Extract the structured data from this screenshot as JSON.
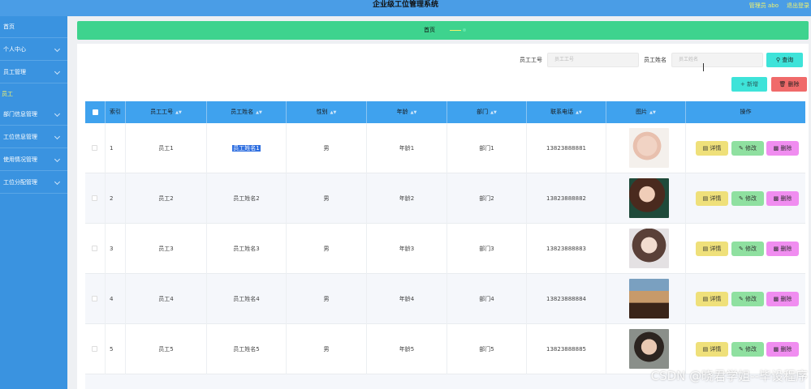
{
  "header": {
    "title": "企业级工位管理系统",
    "admin": "管理员 abo",
    "logout": "退出登录"
  },
  "sidebar": {
    "items": [
      {
        "label": "首页",
        "chevron": false
      },
      {
        "label": "个人中心",
        "chevron": true
      },
      {
        "label": "员工管理",
        "chevron": true
      },
      {
        "label": "部门信息管理",
        "chevron": true
      },
      {
        "label": "工位信息管理",
        "chevron": true
      },
      {
        "label": "使用情况管理",
        "chevron": true
      },
      {
        "label": "工位分配管理",
        "chevron": true
      }
    ],
    "active_sub": "员工"
  },
  "breadcrumb": {
    "home": "首页"
  },
  "search": {
    "id_label": "员工工号",
    "id_placeholder": "员工工号",
    "name_label": "员工姓名",
    "name_placeholder": "员工姓名",
    "query_button": "查询"
  },
  "actions": {
    "add_button": "新增",
    "delete_button": "删除"
  },
  "table": {
    "headers": [
      "索引",
      "员工工号",
      "员工姓名",
      "性别",
      "年龄",
      "部门",
      "联系电话",
      "图片",
      "操作"
    ],
    "row_buttons": {
      "detail": "详情",
      "edit": "修改",
      "delete": "删除"
    },
    "rows": [
      {
        "index": "1",
        "emp_id": "员工1",
        "emp_name": "员工姓名1",
        "gender": "男",
        "age": "年龄1",
        "dept": "部门1",
        "phone": "13823888881"
      },
      {
        "index": "2",
        "emp_id": "员工2",
        "emp_name": "员工姓名2",
        "gender": "男",
        "age": "年龄2",
        "dept": "部门2",
        "phone": "13823888882"
      },
      {
        "index": "3",
        "emp_id": "员工3",
        "emp_name": "员工姓名3",
        "gender": "男",
        "age": "年龄3",
        "dept": "部门3",
        "phone": "13823888883"
      },
      {
        "index": "4",
        "emp_id": "员工4",
        "emp_name": "员工姓名4",
        "gender": "男",
        "age": "年龄4",
        "dept": "部门4",
        "phone": "13823888884"
      },
      {
        "index": "5",
        "emp_id": "员工5",
        "emp_name": "员工姓名5",
        "gender": "男",
        "age": "年龄5",
        "dept": "部门5",
        "phone": "13823888885"
      }
    ]
  },
  "watermark": "CSDN @晓君学姐--毕设程序",
  "colors": {
    "topbar": "#4a9de6",
    "sidebar": "#3a93e0",
    "breadcrumb": "#3ed38e",
    "table_header": "#3fa2ee",
    "accent": "#3ee3d9",
    "danger": "#f06a6a"
  }
}
